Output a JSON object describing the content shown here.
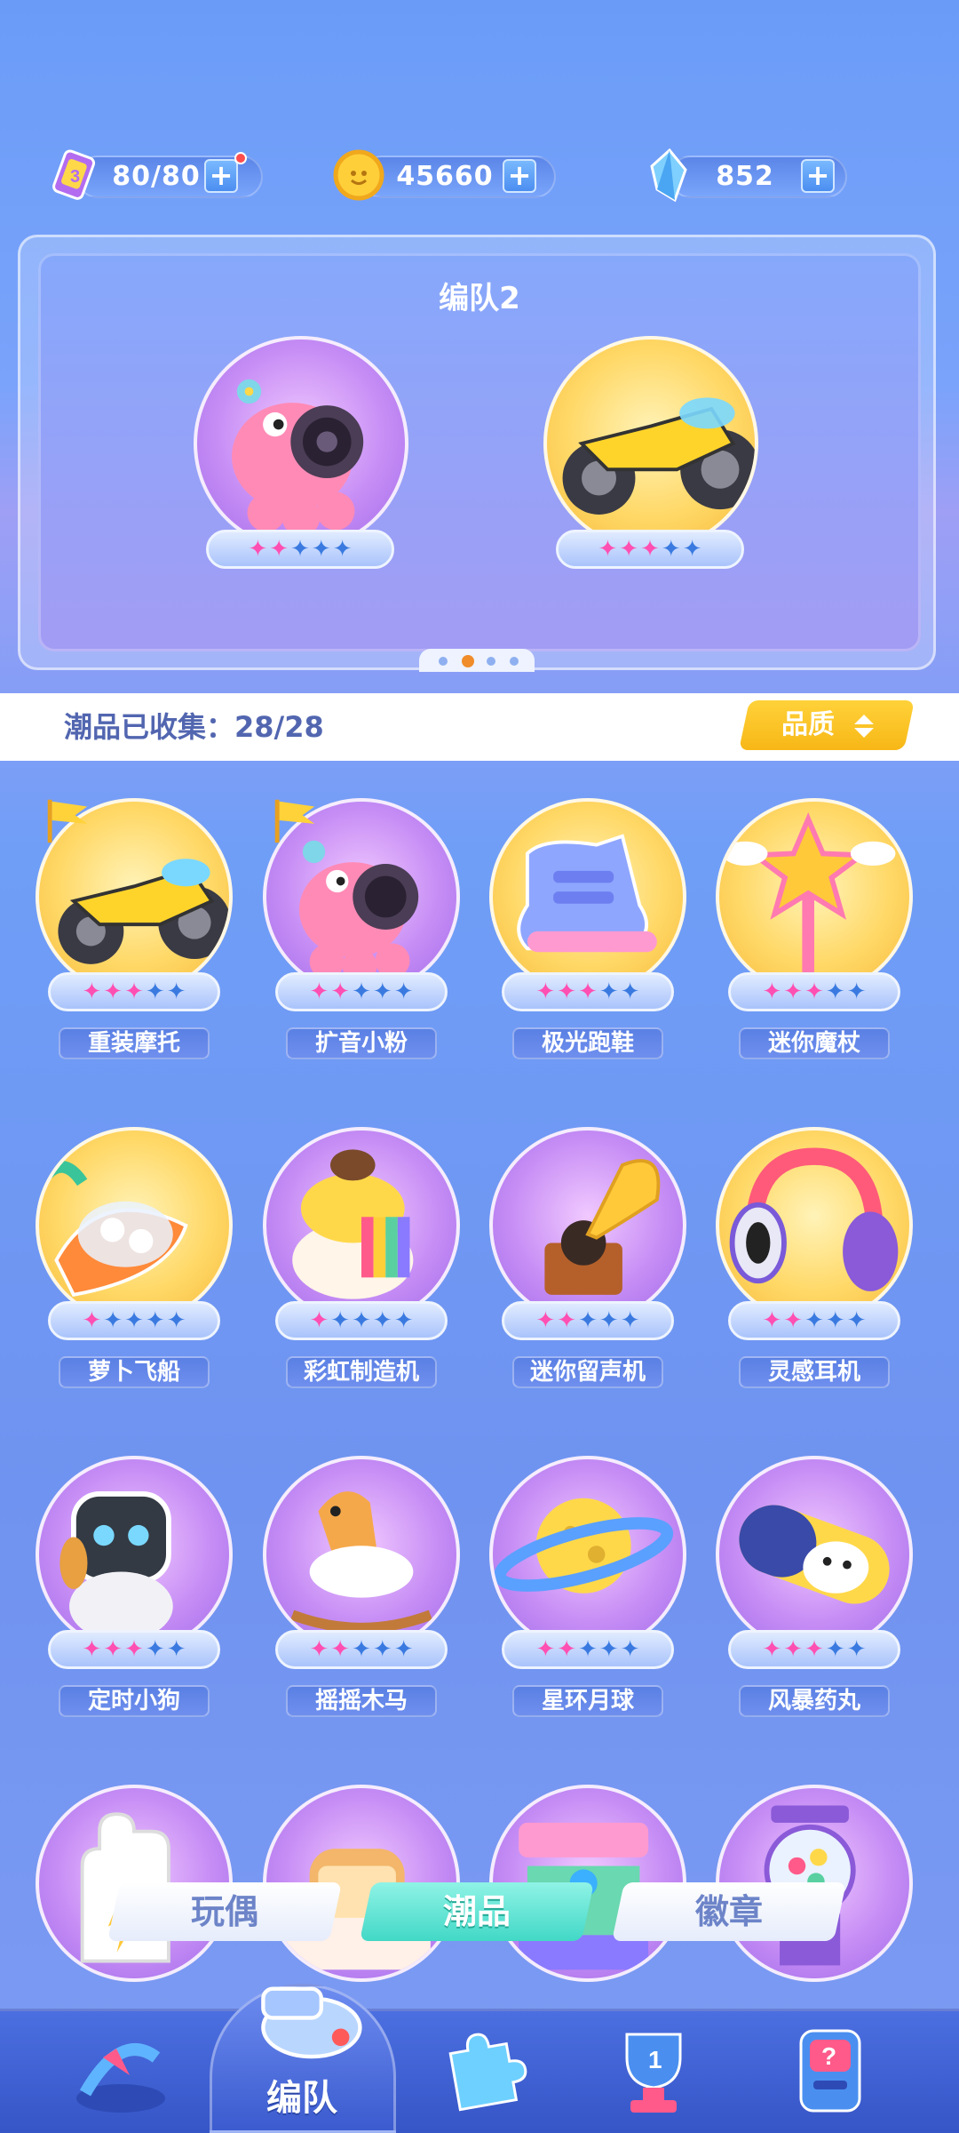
{
  "resources": [
    {
      "name": "stamina",
      "value": "80/80",
      "icon": "ticket-icon"
    },
    {
      "name": "coins",
      "value": "45660",
      "icon": "coin-icon"
    },
    {
      "name": "diamonds",
      "value": "852",
      "icon": "crystal-icon"
    }
  ],
  "squad": {
    "title": "编队2",
    "members": [
      {
        "name": "扩音小粉",
        "stars_on": 2,
        "stars_total": 5
      },
      {
        "name": "重装摩托",
        "stars_on": 3,
        "stars_total": 5
      }
    ],
    "page_dots": 4,
    "active_dot": 1
  },
  "collection": {
    "label": "潮品已收集：",
    "count": "28/28",
    "sort_button": "品质"
  },
  "items": [
    {
      "name": "重装摩托",
      "stars_on": 3,
      "bg": "gold",
      "flag": true,
      "icon": "motorcycle-icon"
    },
    {
      "name": "扩音小粉",
      "stars_on": 2,
      "bg": "purple",
      "flag": true,
      "icon": "speaker-octopus-icon"
    },
    {
      "name": "极光跑鞋",
      "stars_on": 3,
      "bg": "gold",
      "flag": false,
      "icon": "sneaker-icon"
    },
    {
      "name": "迷你魔杖",
      "stars_on": 3,
      "bg": "gold",
      "flag": false,
      "icon": "magic-wand-icon"
    },
    {
      "name": "萝卜飞船",
      "stars_on": 1,
      "bg": "gold",
      "flag": false,
      "icon": "carrot-ship-icon"
    },
    {
      "name": "彩虹制造机",
      "stars_on": 1,
      "bg": "purple",
      "flag": false,
      "icon": "rainbow-machine-icon"
    },
    {
      "name": "迷你留声机",
      "stars_on": 2,
      "bg": "purple",
      "flag": false,
      "icon": "gramophone-icon"
    },
    {
      "name": "灵感耳机",
      "stars_on": 2,
      "bg": "gold",
      "flag": false,
      "icon": "headphones-icon"
    },
    {
      "name": "定时小狗",
      "stars_on": 3,
      "bg": "purple",
      "flag": false,
      "icon": "robot-dog-icon"
    },
    {
      "name": "摇摇木马",
      "stars_on": 2,
      "bg": "purple",
      "flag": false,
      "icon": "rocking-horse-icon"
    },
    {
      "name": "星环月球",
      "stars_on": 2,
      "bg": "purple",
      "flag": false,
      "icon": "planet-icon"
    },
    {
      "name": "风暴药丸",
      "stars_on": 3,
      "bg": "purple",
      "flag": false,
      "icon": "capsule-icon"
    },
    {
      "name": "",
      "stars_on": 0,
      "bg": "purple",
      "flag": false,
      "icon": "glove-icon"
    },
    {
      "name": "",
      "stars_on": 0,
      "bg": "purple",
      "flag": false,
      "icon": "toast-icon"
    },
    {
      "name": "",
      "stars_on": 0,
      "bg": "purple",
      "flag": false,
      "icon": "arcade-machine-icon"
    },
    {
      "name": "",
      "stars_on": 0,
      "bg": "purple",
      "flag": false,
      "icon": "gumball-machine-icon"
    }
  ],
  "tabs": [
    {
      "label": "玩偶",
      "active": false
    },
    {
      "label": "潮品",
      "active": true
    },
    {
      "label": "徽章",
      "active": false
    }
  ],
  "nav": {
    "active_label": "编队",
    "items": [
      "bow-icon",
      "whistle-icon",
      "puzzle-icon",
      "trophy-icon",
      "mystery-machine-icon"
    ]
  },
  "colors": {
    "star_on": "#ff4fb2",
    "star_off": "#3a7ae0",
    "accent_yellow": "#f7b716",
    "tab_active": "#5fe3d3"
  }
}
